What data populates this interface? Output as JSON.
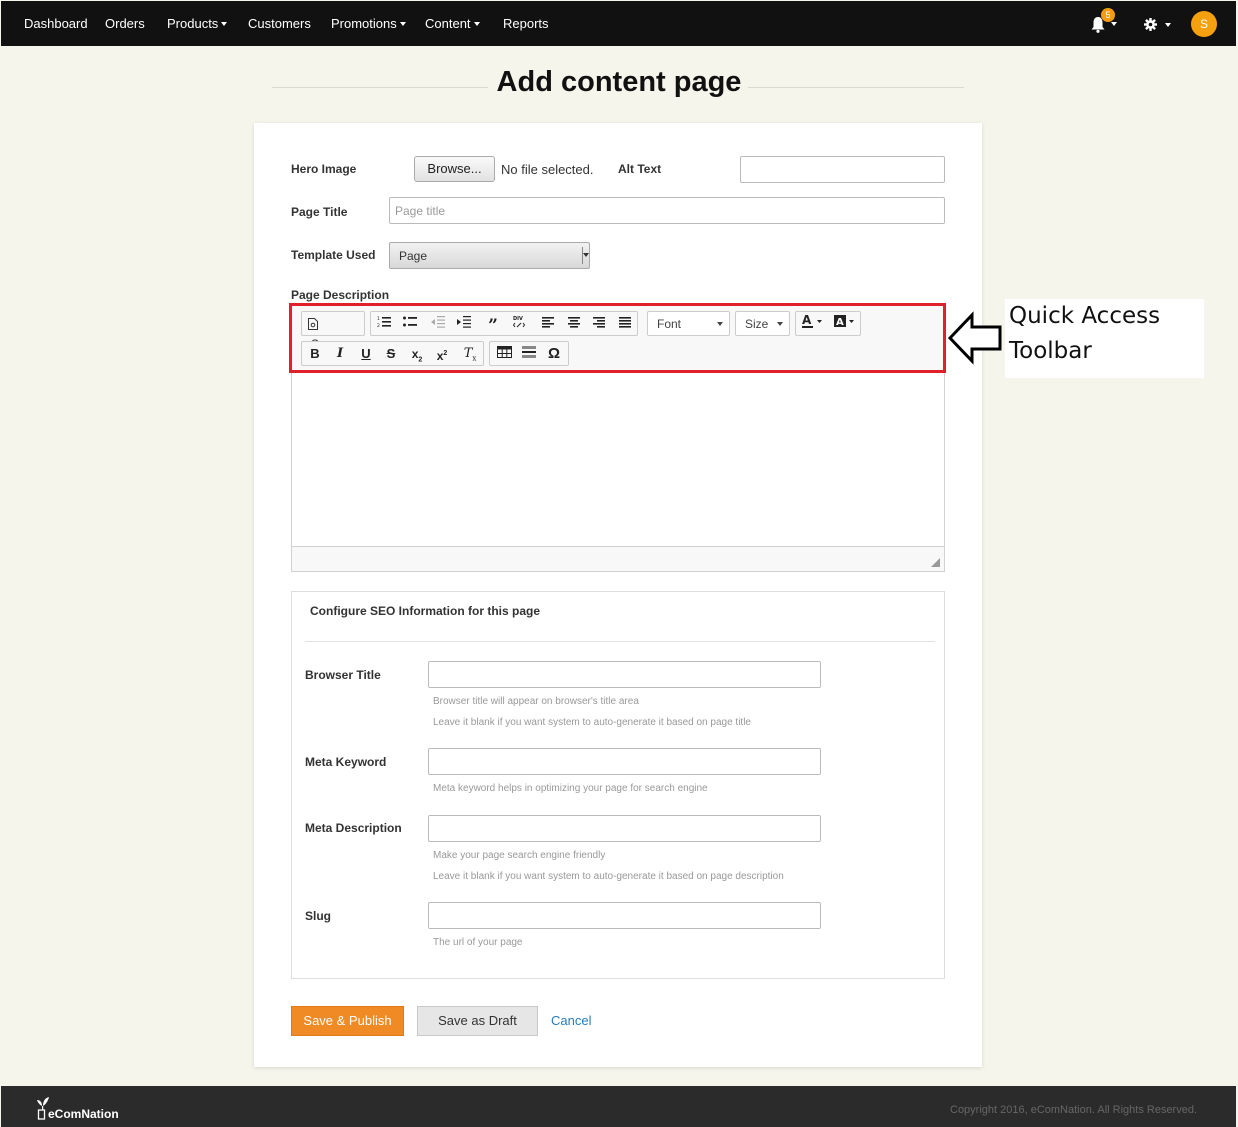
{
  "nav": {
    "items": [
      "Dashboard",
      "Orders",
      "Products",
      "Customers",
      "Promotions",
      "Content",
      "Reports"
    ],
    "notification_count": "5",
    "avatar_initial": "S"
  },
  "page": {
    "title": "Add content page"
  },
  "form": {
    "hero_image_label": "Hero Image",
    "browse_label": "Browse...",
    "no_file_text": "No file selected.",
    "alt_text_label": "Alt Text",
    "page_title_label": "Page Title",
    "page_title_placeholder": "Page title",
    "template_label": "Template Used",
    "template_value": "Page",
    "description_label": "Page Description"
  },
  "editor": {
    "source_label": "Source",
    "font_label": "Font",
    "size_label": "Size"
  },
  "annotation": {
    "line1": "Quick Access",
    "line2": "Toolbar"
  },
  "seo": {
    "title": "Configure SEO Information for this page",
    "browser_title_label": "Browser Title",
    "browser_title_help1": "Browser title will appear on browser's title area",
    "browser_title_help2": "Leave it blank if you want system to auto-generate it based on page title",
    "meta_keyword_label": "Meta Keyword",
    "meta_keyword_help": "Meta keyword helps in optimizing your page for search engine",
    "meta_description_label": "Meta Description",
    "meta_description_help1": "Make your page search engine friendly",
    "meta_description_help2": "Leave it blank if you want system to auto-generate it based on page description",
    "slug_label": "Slug",
    "slug_help": "The url of your page"
  },
  "actions": {
    "publish_label": "Save & Publish",
    "draft_label": "Save as Draft",
    "cancel_label": "Cancel"
  },
  "footer": {
    "logo_text": "eComNation",
    "copyright": "Copyright 2016, eComNation. All Rights Reserved."
  },
  "colors": {
    "primary": "#f08a24",
    "highlight": "#e0202a",
    "nav_bg": "#111111",
    "link": "#2a7ab8"
  }
}
